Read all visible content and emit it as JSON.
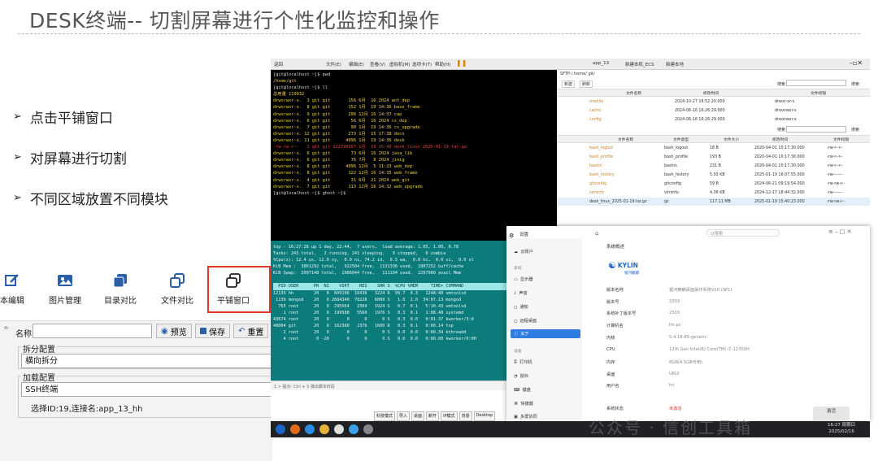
{
  "slide": {
    "title": "DESK终端-- 切割屏幕进行个性化监控和操作",
    "bullets": [
      "点击平铺窗口",
      "对屏幕进行切割",
      "不同区域放置不同模块"
    ]
  },
  "app_toolbar": {
    "buttons": [
      {
        "label": "本编辑",
        "icon": "edit-icon"
      },
      {
        "label": "图片管理",
        "icon": "image-icon"
      },
      {
        "label": "目录对比",
        "icon": "folder-compare-icon"
      },
      {
        "label": "文件对比",
        "icon": "file-compare-icon"
      },
      {
        "label": "平铺窗口",
        "icon": "tile-window-icon"
      }
    ],
    "highlight_color": "#e0392b"
  },
  "app_form": {
    "name_label": "名称",
    "name_value": "",
    "preview_label": "预览",
    "save_label": "保存",
    "reset_label": "重置",
    "split_group": "拆分配置",
    "split_value": "横向拆分",
    "load_group": "加载配置",
    "load_value": "SSH终端",
    "select_label": "选择",
    "select_value": "ID:19,连接名:app_13_hh"
  },
  "desktop_topbar": {
    "back": "返回",
    "menus": [
      "文件(E)",
      "编辑(E)",
      "查看(V)",
      "虚拟机(M)",
      "选项卡(T)",
      "帮助(H)"
    ],
    "tabs": [
      "app_13",
      "新建本机_ECS",
      "新建本地"
    ]
  },
  "terminal": {
    "lines": [
      "[git@localhost ~]$ pwd",
      "/home/git",
      "[git@localhost ~]$ ll",
      "总用量 119932",
      "drwxrwxr-x.  3 git git       156 6月  16 2024 ant_dep",
      "drwxrwxr-x.  8 git git       152 1月  19 14:36 base_frame",
      "drwxrwxr-x.  9 git git       206 12月 16 14:37 cap",
      "drwxrwxr-x.  6 git git        56 6月  16 2024 cs_dep",
      "drwxrwxr-x.  7 git git        90 1月  19 14:36 cs_upgrade",
      "drwxrwxr-x. 12 git git       273 1月  15 17:38 docs",
      "drwxrwxr-x. 11 git git      4096 1月  19 14:36 desk",
      "-rw-rw-r--   1 git git 122799667 1月  19 15:40 desk_linux_2025-01-19.tar.gz",
      "drwxrwxr-x.  6 git git        73 6月  16 2024 java_lib",
      "drwxrwxr-x.  6 git git        76 7月   8 2024 jinig",
      "drwxrwxr-x.  8 git git      4096 12月  5 11:23 web_dep",
      "drwxrwxr-x.  8 git git       122 12月 16 14:35 web_frame",
      "drwxrwxr-x.  4 git git        31 6月  21 2024 web_git",
      "drwxrwxr-x.  7 git git       113 12月 16 14:32 web_upgrade",
      "[git@localhost ~]$ ghost ~]$"
    ]
  },
  "top_monitor": {
    "lines": [
      "top - 16:27:28 up 1 day, 22:44,  7 users,  load average: 1.05, 1.00, 0.78",
      "Tasks: 243 total,   2 running, 241 sleeping,   0 stopped,   0 zombie",
      "%Cpu(s): 12.4 us, 12.9 sy,  0.0 ni, 74.2 id,  0.5 wa,  0.0 hi,  0.0 si,  0.0 st",
      "KiB Mem :  3861292 total,   922504 free,  1131336 used,  1807252 buff/cache",
      "KiB Swap:  2097148 total,  1986044 free,   111104 used.  2297980 avail Mem"
    ],
    "header": "  PID USER      PR  NI    VIRT    RES    SHR S  %CPU %MEM     TIME+ COMMAND",
    "rows": [
      "12135 hh        20   0  609196  10436   3224 R  99.7  0.3   1248:40 vmtoolsd",
      " 1139 mongod    20   0 2684340  78228   6000 S   1.0  2.0  34:07.13 mongod",
      "  765 root      20   0  295564   2304   1924 S   0.7  0.1   5:10.43 vmtoolsd",
      "    1 root      20   0  199588   5560   1976 S   0.3  0.1   1:08.48 systemd",
      "43674 root      20   0       0      0      0 S   0.3  0.0   0:01.37 kworker/3:0",
      "48004 git       20   0  162380   2376   1600 R   0.3  0.1   0:00.14 top",
      "    2 root      20   0       0      0      0 S   0.0  0.0   0:00.34 kthreadd",
      "    4 root       0 -20       0      0      0 S   0.0  0.0   0:00.00 kworker/0:0H"
    ],
    "status": "1 > 提示: Ctrl + S 弹出脚本时段"
  },
  "file_manager": {
    "sftp_path": "SFTP:/ home/ git/",
    "search_label": "搜索",
    "search_btn": "搜索",
    "toolbar": [
      "新建",
      "刷新"
    ],
    "upper_headers": [
      "文件名称",
      "修改时间",
      "文件权限"
    ],
    "upper_rows": [
      {
        "name": "mozilla",
        "time": "2024-10-27 18:52:20.000",
        "perm": "drwxr-xr-x"
      },
      {
        "name": "cache",
        "time": "2024-06-16 16:26:29.000",
        "perm": "drwxrwxr-x"
      },
      {
        "name": "config",
        "time": "2024-06-16 16:26:29.000",
        "perm": "drwxrwxr-x"
      }
    ],
    "lower_headers": [
      "文件名称",
      "文件类型",
      "文件大小",
      "修改时间",
      "文件权限"
    ],
    "lower_rows": [
      {
        "name": "bash_logout",
        "type": "bash_logout",
        "size": "18 B",
        "time": "2020-04-01 10:17:30.000",
        "perm": "-rw-r--r--"
      },
      {
        "name": "bash_profile",
        "type": "bash_profile",
        "size": "193 B",
        "time": "2020-04-01 10:17:30.000",
        "perm": "-rw-r--r--"
      },
      {
        "name": "bashrc",
        "type": "bashrc",
        "size": "231 B",
        "time": "2020-04-01 10:17:30.000",
        "perm": "-rw-r--r--"
      },
      {
        "name": "bash_history",
        "type": "bash_history",
        "size": "5.93 KB",
        "time": "2025-01-19 16:07:55.000",
        "perm": "-rw-------"
      },
      {
        "name": "gitconfig",
        "type": "gitconfig",
        "size": "59 B",
        "time": "2024-06-21 09:19:54.000",
        "perm": "-rw-rw-r--"
      },
      {
        "name": "viminfo",
        "type": "viminfo",
        "size": "4.06 KB",
        "time": "2024-12-17 18:44:32.000",
        "perm": "-rw-------"
      },
      {
        "name": "desk_linux_2025-01-19.tar.gz",
        "type": "gz",
        "size": "117.11 MB",
        "time": "2025-01-19 15:40:23.000",
        "perm": "-rw-rw-r--"
      }
    ]
  },
  "settings": {
    "title": "设置",
    "search_placeholder": "Q搜索",
    "section": "系统概述",
    "brand": "KYLIN",
    "brand_sub": "银河麒麟",
    "side_items": [
      {
        "label": "云账户",
        "group": ""
      },
      {
        "label": "显示器",
        "group": "系统"
      },
      {
        "label": "声音",
        "group": ""
      },
      {
        "label": "通知",
        "group": ""
      },
      {
        "label": "远程桌面",
        "group": ""
      },
      {
        "label": "关于",
        "group": "",
        "active": true
      },
      {
        "label": "打印机",
        "group": "设备"
      },
      {
        "label": "鼠标",
        "group": ""
      },
      {
        "label": "键盘",
        "group": ""
      },
      {
        "label": "快捷键",
        "group": ""
      },
      {
        "label": "多屏协同",
        "group": ""
      }
    ],
    "groups": [
      "系统",
      "设备"
    ],
    "fields": [
      {
        "k": "版本名称",
        "v": "银河麒麟桌面操作系统V10 (SP1)"
      },
      {
        "k": "版本号",
        "v": "2303"
      },
      {
        "k": "系统补丁版本号",
        "v": "2303"
      },
      {
        "k": "计算机名",
        "v": "hh-pc"
      },
      {
        "k": "内核",
        "v": "5.4.18-85-generic"
      },
      {
        "k": "CPU",
        "v": "12th Gen Intel(R) Core(TM) i7-12700H"
      },
      {
        "k": "内存",
        "v": "8GB(4.5GB可用)"
      },
      {
        "k": "桌面",
        "v": "UKUI"
      },
      {
        "k": "用户名",
        "v": "hh"
      },
      {
        "k": "系统状态",
        "v": "未激活"
      }
    ],
    "activate_btn": "激活"
  },
  "taskbar": {
    "time": "16:27 周期日",
    "date": "2025/02/16"
  },
  "bottom_tabs": [
    "科技模式",
    "导入",
    "桌面",
    "断开",
    "IP模式",
    "背景",
    "Desktop"
  ],
  "watermark": "公众号 · 信创工具箱"
}
